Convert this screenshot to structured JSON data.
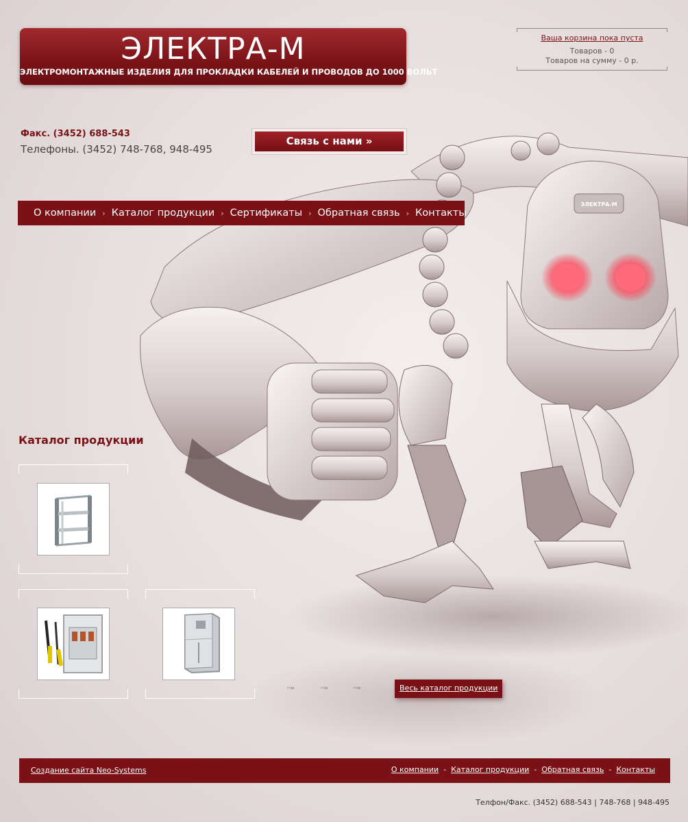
{
  "header": {
    "logo_title": "ЭЛЕКТРА-М",
    "logo_subtitle": "ЭЛЕКТРОМОНТАЖНЫЕ ИЗДЕЛИЯ ДЛЯ ПРОКЛАДКИ КАБЕЛЕЙ И ПРОВОДОВ ДО 1000 ВОЛЬТ"
  },
  "cart": {
    "status_link": "Ваша корзина пока пуста",
    "items_line": "Товаров - 0",
    "sum_line": "Товаров на сумму - 0 р."
  },
  "contacts": {
    "fax": "Факс. (3452)  688-543",
    "phones": "Телефоны. (3452) 748-768, 948-495",
    "contact_button": "Связь с нами »"
  },
  "nav": {
    "items": [
      {
        "label": "О компании"
      },
      {
        "label": "Каталог продукции"
      },
      {
        "label": "Сертификаты"
      },
      {
        "label": "Обратная связь"
      },
      {
        "label": "Контакты"
      }
    ],
    "separator": "›"
  },
  "robot": {
    "badge": "ЭЛЕКТРА-М"
  },
  "catalog": {
    "title": "Каталог продукции",
    "products": [
      {
        "icon": "shelf-rack-icon"
      },
      {
        "icon": "electrical-cabinet-with-tools-icon"
      },
      {
        "icon": "electrical-cabinet-icon"
      }
    ],
    "arrows": [
      "···››",
      "···››",
      "···››"
    ],
    "all_link": "Весь каталог продукции"
  },
  "footer": {
    "credit": "Создание сайта Neo-Systems",
    "links": [
      {
        "label": "О компании"
      },
      {
        "label": "Каталог продукции"
      },
      {
        "label": "Обратная связь"
      },
      {
        "label": "Контакты"
      }
    ],
    "link_separator": "-",
    "phones": "Телфон/Факс. (3452)  688-543 | 748-768 | 948-495"
  },
  "colors": {
    "brand": "#7a1116",
    "background": "#e7dede",
    "robot_eyes": "#ff4a5a"
  }
}
